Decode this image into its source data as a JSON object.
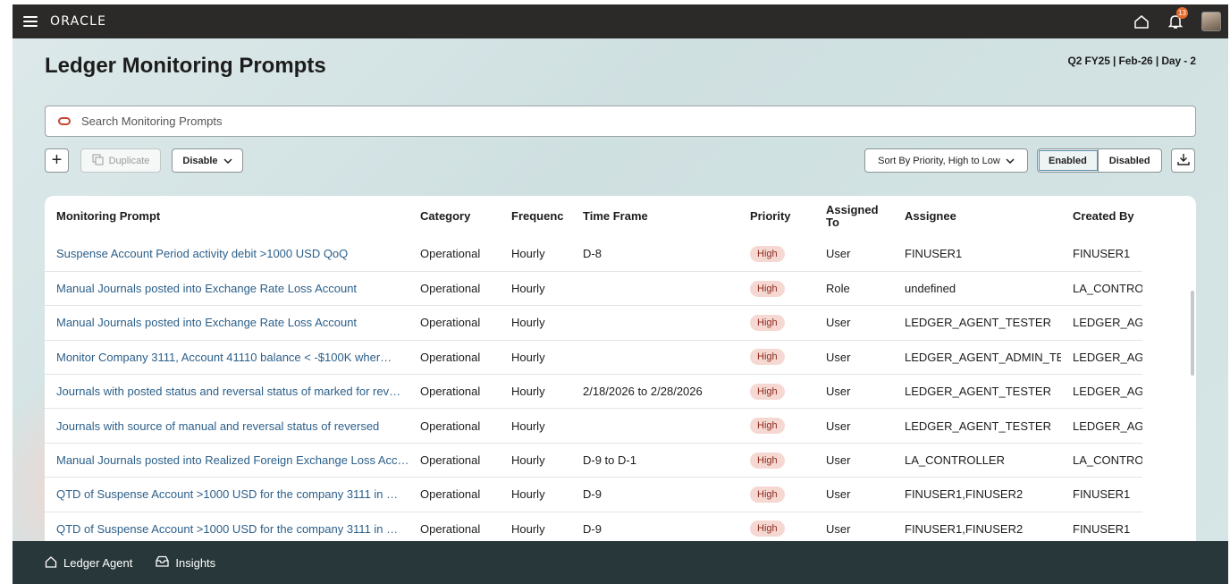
{
  "app": {
    "logo": "ORACLE",
    "notification_count": "13"
  },
  "header": {
    "title": "Ledger Monitoring Prompts",
    "period": "Q2 FY25 | Feb-26 | Day - 2"
  },
  "search": {
    "placeholder": "Search Monitoring Prompts"
  },
  "toolbar": {
    "add_label": "+",
    "duplicate_label": "Duplicate",
    "disable_label": "Disable",
    "sort_label": "Sort By Priority, High to Low",
    "enabled_label": "Enabled",
    "disabled_label": "Disabled"
  },
  "table": {
    "columns": [
      "Monitoring Prompt",
      "Category",
      "Frequenc",
      "Time Frame",
      "Priority",
      "Assigned To",
      "Assignee",
      "Created By"
    ],
    "rows": [
      [
        "Suspense Account Period activity debit >1000 USD QoQ",
        "Operational",
        "Hourly",
        "D-8",
        "High",
        "User",
        "FINUSER1",
        "FINUSER1"
      ],
      [
        "Manual Journals posted into Exchange Rate Loss Account",
        "Operational",
        "Hourly",
        "",
        "High",
        "Role",
        "undefined",
        "LA_CONTROL"
      ],
      [
        "Manual Journals posted into Exchange Rate Loss Account",
        "Operational",
        "Hourly",
        "",
        "High",
        "User",
        "LEDGER_AGENT_TESTER",
        "LEDGER_AGE"
      ],
      [
        "Monitor Company 3111, Account 41110 balance < -$100K wher…",
        "Operational",
        "Hourly",
        "",
        "High",
        "User",
        "LEDGER_AGENT_ADMIN_TEST",
        "LEDGER_AGE"
      ],
      [
        "Journals with posted status and reversal status of marked for rev…",
        "Operational",
        "Hourly",
        "2/18/2026 to 2/28/2026",
        "High",
        "User",
        "LEDGER_AGENT_TESTER",
        "LEDGER_AGE"
      ],
      [
        "Journals with source of manual and reversal status of reversed",
        "Operational",
        "Hourly",
        "",
        "High",
        "User",
        "LEDGER_AGENT_TESTER",
        "LEDGER_AGE"
      ],
      [
        "Manual Journals posted into Realized Foreign Exchange Loss Acc…",
        "Operational",
        "Hourly",
        "D-9 to D-1",
        "High",
        "User",
        "LA_CONTROLLER",
        "LA_CONTROL"
      ],
      [
        "QTD of Suspense Account >1000 USD for the company 3111 in …",
        "Operational",
        "Hourly",
        "D-9",
        "High",
        "User",
        "FINUSER1,FINUSER2",
        "FINUSER1"
      ],
      [
        "QTD of Suspense Account >1000 USD for the company 3111 in …",
        "Operational",
        "Hourly",
        "D-9",
        "High",
        "User",
        "FINUSER1,FINUSER2",
        "FINUSER1"
      ]
    ]
  },
  "bottom_nav": {
    "ledger_agent": "Ledger Agent",
    "insights": "Insights"
  },
  "colors": {
    "topbar": "#2c2a28",
    "bottombar": "#28373a",
    "link": "#2b5f8a",
    "pill_bg": "#f6d8d2",
    "accent": "#c74634"
  }
}
